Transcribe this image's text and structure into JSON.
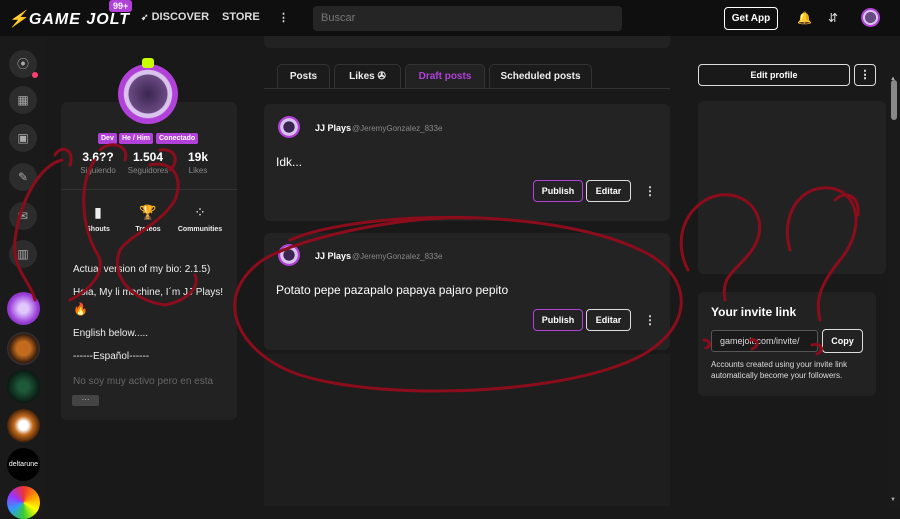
{
  "header": {
    "logo": "GAME JOLT",
    "notif_badge": "99+",
    "nav": [
      "DISCOVER",
      "STORE"
    ],
    "search_placeholder": "Buscar",
    "get_app": "Get App"
  },
  "profile": {
    "tags": [
      "Dev",
      "He / Him",
      "Conectado"
    ],
    "stats": [
      {
        "value": "3.6??",
        "label": "Siguiendo"
      },
      {
        "value": "1.504",
        "label": "Seguidores"
      },
      {
        "value": "19k",
        "label": "Likes"
      }
    ],
    "quick_links": [
      "Shouts",
      "Trofeos",
      "Communities"
    ],
    "bio": [
      "Actual version of my bio: 2.1.5)",
      "Hola, My li machine, I´m JJ Plays!",
      "English below.....",
      "------Español------",
      "No soy muy activo pero en esta"
    ],
    "more": "···"
  },
  "tabs": [
    {
      "label": "Posts"
    },
    {
      "label": "Likes"
    },
    {
      "label": "Draft posts"
    },
    {
      "label": "Scheduled posts"
    }
  ],
  "posts": [
    {
      "author": "JJ Plays",
      "handle": "@JeremyGonzalez_833e",
      "body": "Idk...",
      "publish": "Publish",
      "edit": "Editar"
    },
    {
      "author": "JJ Plays",
      "handle": "@JeremyGonzalez_833e",
      "body": "Potato pepe pazapalo papaya pajaro pepito",
      "publish": "Publish",
      "edit": "Editar"
    }
  ],
  "right": {
    "edit_profile": "Edit profile",
    "invite_title": "Your invite link",
    "invite_value": "gamejolt.com/invite/",
    "copy": "Copy",
    "invite_desc": "Accounts created using your invite link automatically become your followers."
  },
  "colors": {
    "accent": "#b141d9",
    "scribble": "#8b0d1c",
    "lime": "#caff00"
  }
}
